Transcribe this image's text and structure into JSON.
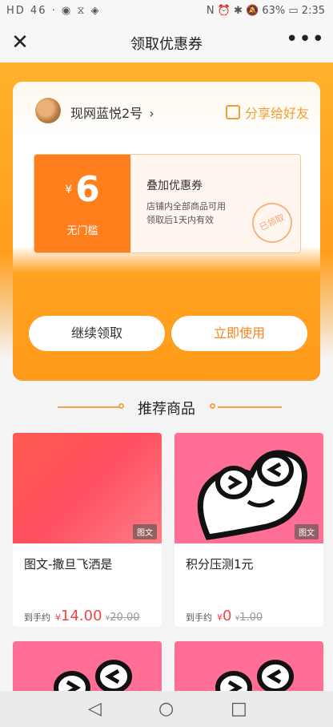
{
  "statusbar": {
    "left": "HD 46 ⋅ ◉ ⧖ ◈",
    "right": "N ⏰ ✱ 🔕 63% ▭ 2:35"
  },
  "navbar": {
    "title": "领取优惠券",
    "close_icon": "close-icon",
    "more_icon": "more-icon"
  },
  "shop": {
    "name": "现网蓝悦2号",
    "chevron": "›",
    "share_label": "分享给好友"
  },
  "coupon": {
    "currency": "¥",
    "amount": "6",
    "condition": "无门槛",
    "name": "叠加优惠券",
    "desc1": "店铺内全部商品可用",
    "desc2": "领取后1天内有效",
    "stamp": "已领取"
  },
  "buttons": {
    "continue": "继续领取",
    "use": "立即使用"
  },
  "recommend": {
    "title": "推荐商品"
  },
  "products": [
    {
      "title": "图文-撒旦飞洒是",
      "tag": "图文",
      "price_prefix": "到手约",
      "currency": "¥",
      "price": "14.00",
      "orig_currency": "¥",
      "orig_price": "20.00"
    },
    {
      "title": "积分压测1元",
      "tag": "图文",
      "price_prefix": "到手约",
      "currency": "¥",
      "price": "0",
      "orig_currency": "¥",
      "orig_price": "1.00"
    }
  ],
  "bottomnav": {
    "back": "◁",
    "home": "○",
    "recent": "□"
  },
  "colors": {
    "accent": "#ff9d1b",
    "coupon": "#ff7f1d",
    "price": "#f5424a",
    "pink": "#ff6f95"
  }
}
